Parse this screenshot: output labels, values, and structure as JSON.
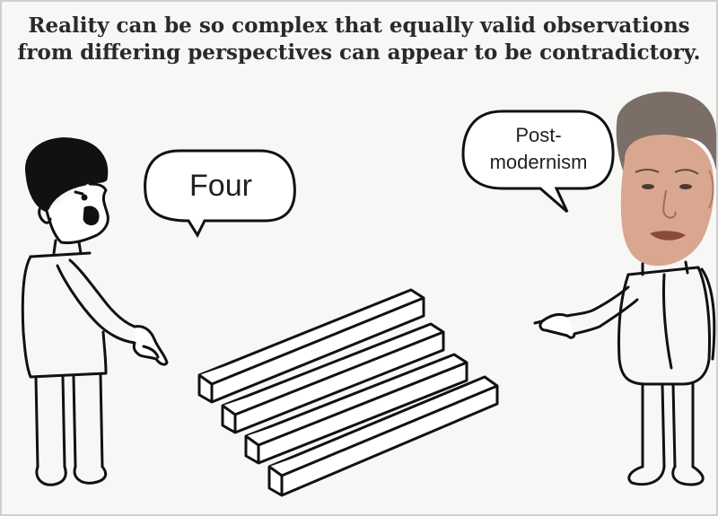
{
  "caption": {
    "line1": "Reality can be so complex that equally valid observations",
    "line2": "from differing perspectives can appear to be contradictory."
  },
  "left_bubble": {
    "text": "Four"
  },
  "right_bubble": {
    "line1": "Post-",
    "line2": "modernism"
  },
  "colors": {
    "ink": "#111111",
    "paper": "#f7f7f5",
    "skin": "#d9a690",
    "hair": "#7a6e66"
  }
}
